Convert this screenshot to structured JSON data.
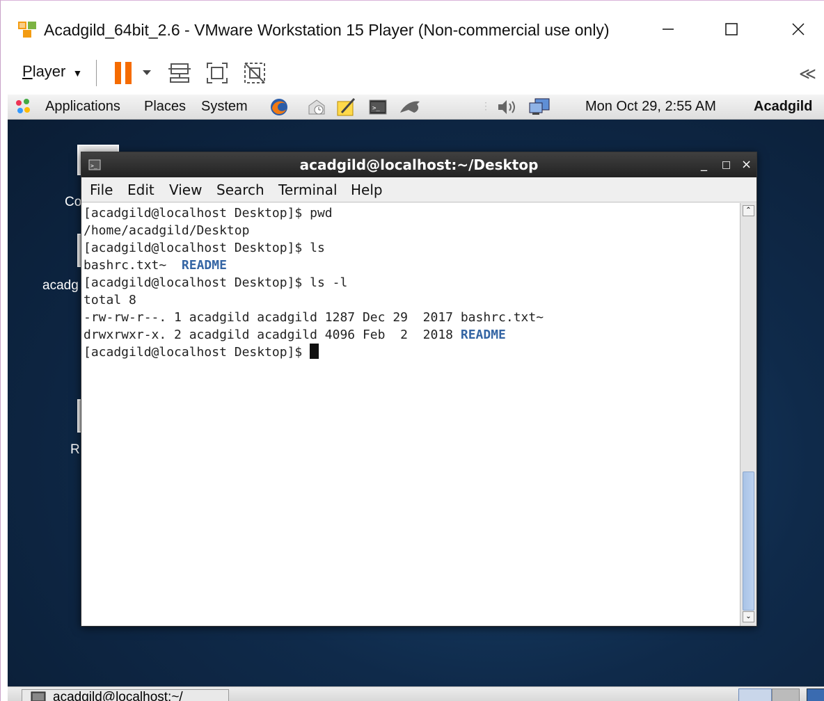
{
  "host": {
    "title": "Acadgild_64bit_2.6 - VMware Workstation 15 Player (Non-commercial use only)",
    "player_menu_first": "P",
    "player_menu_rest": "layer",
    "collapse": "≪"
  },
  "panel": {
    "applications": "Applications",
    "places": "Places",
    "system": "System",
    "clock": "Mon Oct 29,  2:55 AM",
    "user": "Acadgild"
  },
  "desktop": {
    "label_co": "Co",
    "label_acad": "acadg",
    "label_r": "R"
  },
  "terminal": {
    "title": "acadgild@localhost:~/Desktop",
    "menus": [
      "File",
      "Edit",
      "View",
      "Search",
      "Terminal",
      "Help"
    ],
    "lines": [
      "[acadgild@localhost Desktop]$ pwd",
      "/home/acadgild/Desktop",
      "[acadgild@localhost Desktop]$ ls",
      "bashrc.txt~  ",
      "[acadgild@localhost Desktop]$ ls -l",
      "total 8",
      "-rw-rw-r--. 1 acadgild acadgild 1287 Dec 29  2017 bashrc.txt~",
      "drwxrwxr-x. 2 acadgild acadgild 4096 Feb  2  2018 ",
      "[acadgild@localhost Desktop]$ "
    ],
    "dir_name": "README"
  },
  "taskbar": {
    "item": "acadgild@localhost:~/"
  }
}
